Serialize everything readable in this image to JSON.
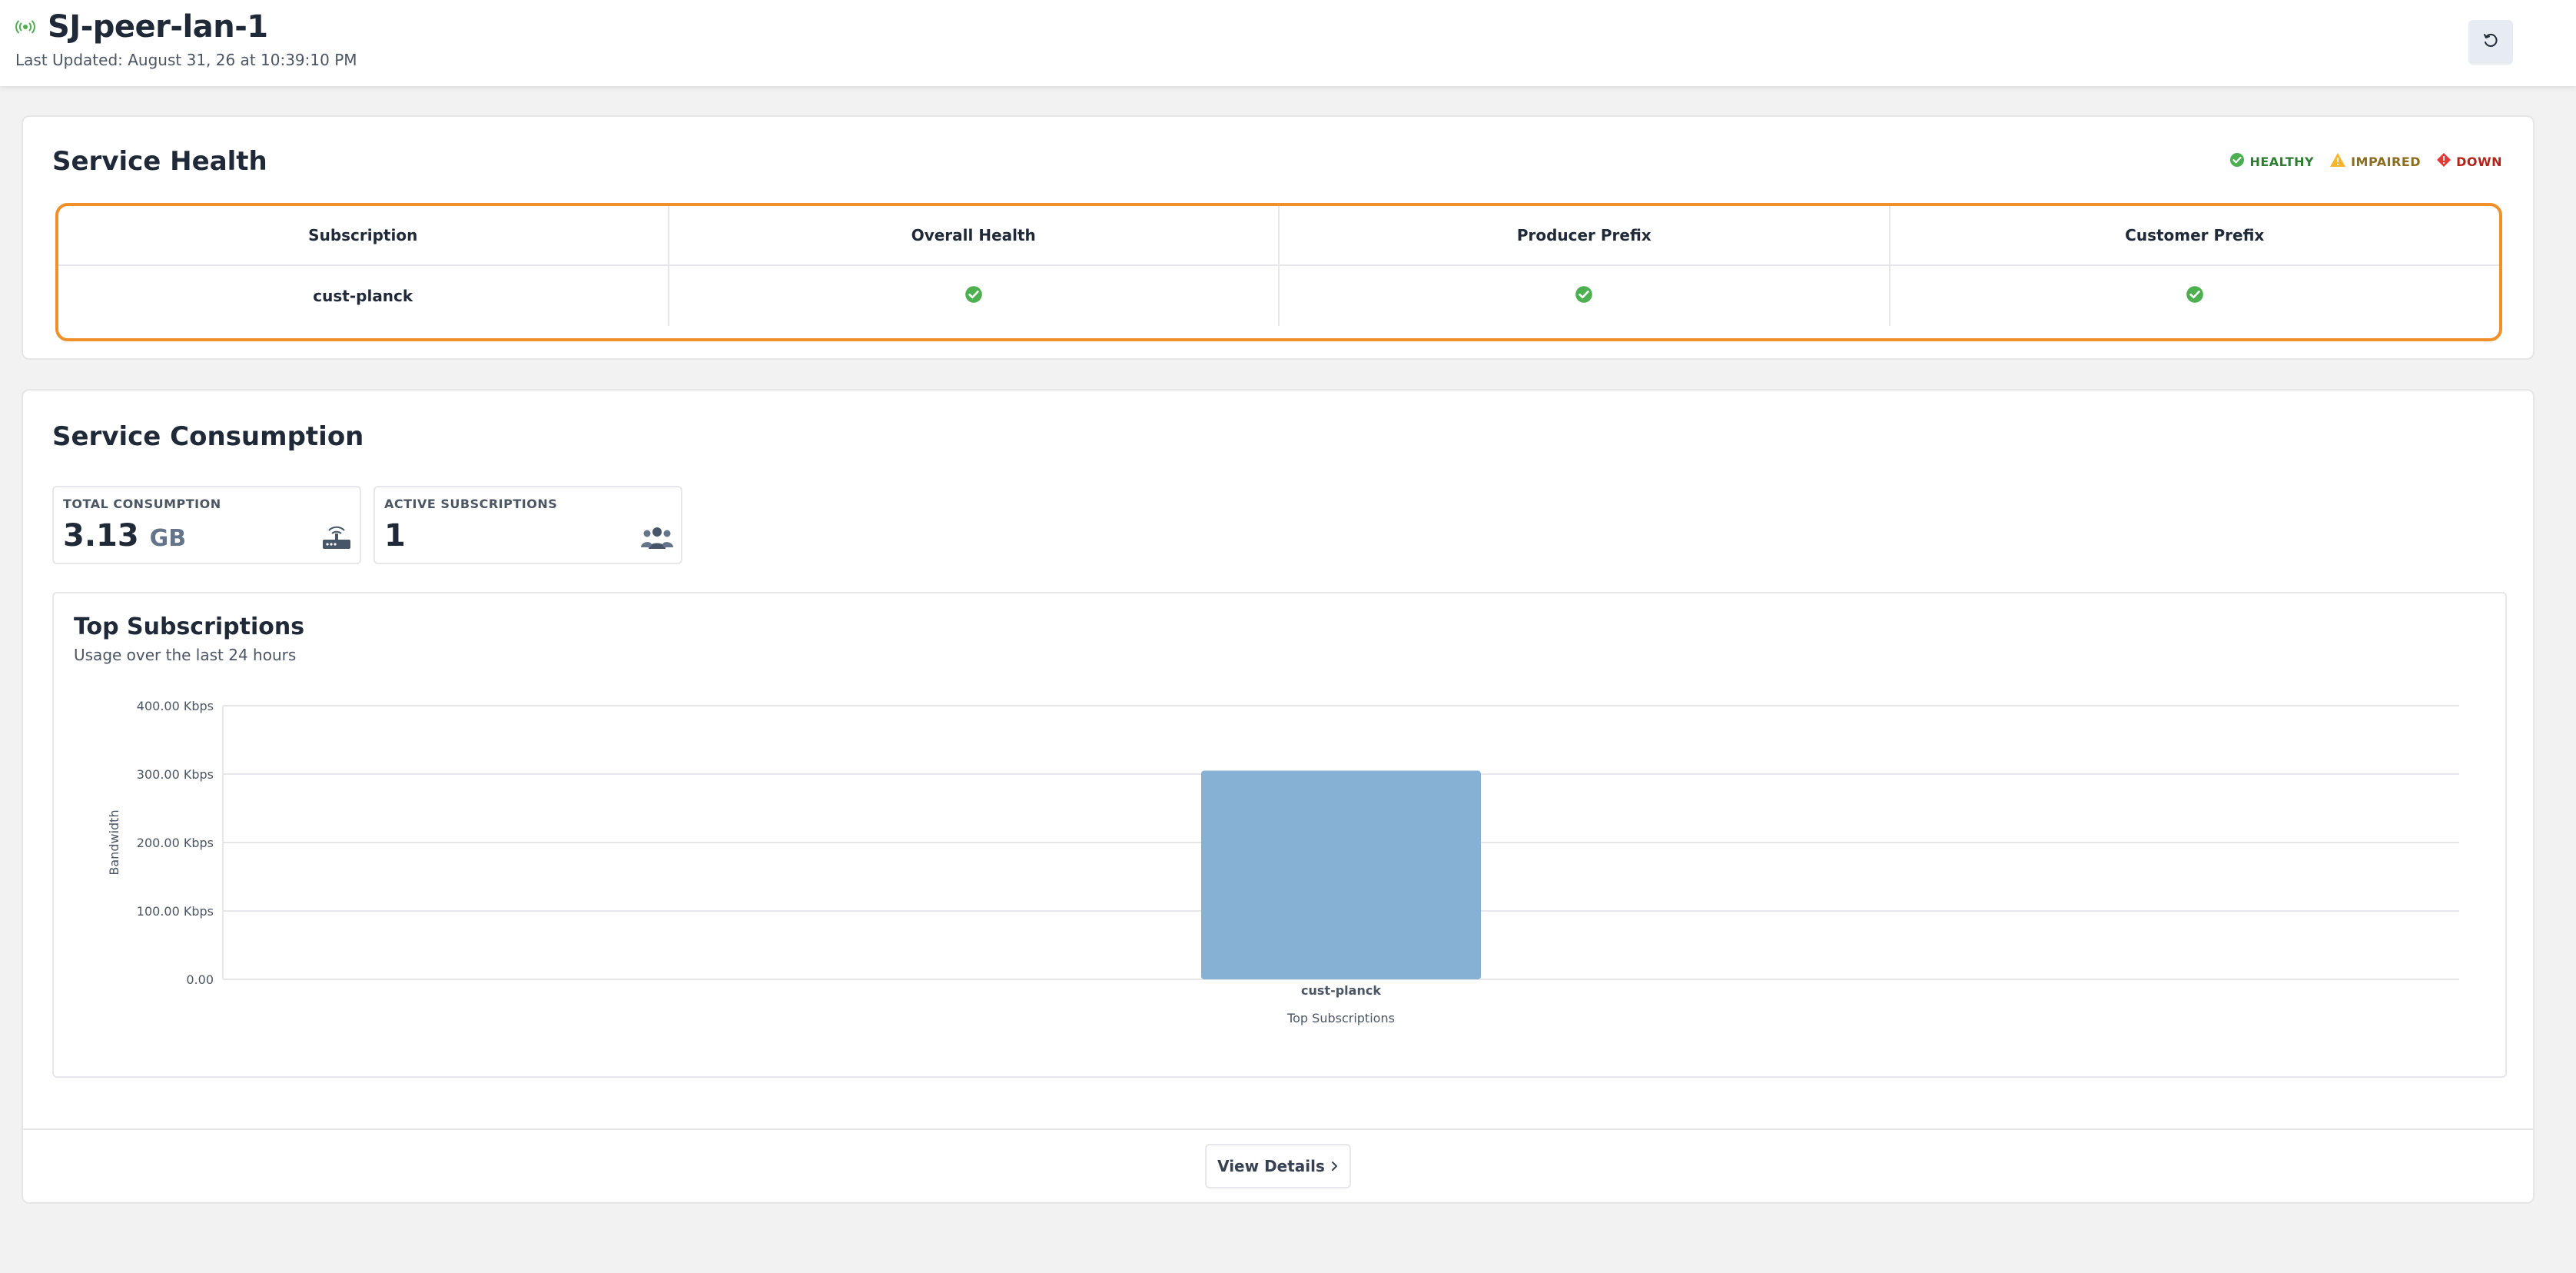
{
  "header": {
    "title": "SJ-peer-lan-1",
    "last_updated": "Last Updated: August 31, 26 at 10:39:10 PM"
  },
  "service_health": {
    "title": "Service Health",
    "legend": [
      {
        "label": "HEALTHY",
        "color": "#2e7d32"
      },
      {
        "label": "IMPAIRED",
        "color": "#8a6d1f"
      },
      {
        "label": "DOWN",
        "color": "#b42318"
      }
    ],
    "columns": [
      "Subscription",
      "Overall Health",
      "Producer Prefix",
      "Customer Prefix"
    ],
    "rows": [
      {
        "subscription": "cust-planck",
        "overall_health": "healthy",
        "producer_prefix": "healthy",
        "customer_prefix": "healthy"
      }
    ],
    "highlight_color": "#f0902a"
  },
  "service_consumption": {
    "title": "Service Consumption",
    "stats": [
      {
        "label": "TOTAL CONSUMPTION",
        "value": "3.13",
        "unit": "GB",
        "icon": "router-icon"
      },
      {
        "label": "ACTIVE SUBSCRIPTIONS",
        "value": "1",
        "unit": "",
        "icon": "users-icon"
      }
    ],
    "view_details_label": "View Details"
  },
  "chart_data": {
    "type": "bar",
    "title": "Top Subscriptions",
    "subtitle": "Usage over the last 24 hours",
    "xlabel": "Top Subscriptions",
    "ylabel": "Bandwidth",
    "categories": [
      "cust-planck"
    ],
    "values": [
      305
    ],
    "unit": "Kbps",
    "ylim": [
      0,
      400
    ],
    "yticks": [
      0,
      100,
      200,
      300,
      400
    ],
    "ytick_labels": [
      "0.00",
      "100.00 Kbps",
      "200.00 Kbps",
      "300.00 Kbps",
      "400.00 Kbps"
    ],
    "bar_color": "#87b1d4",
    "grid": true
  },
  "colors": {
    "healthy": "#4caf50",
    "accent": "#f0902a"
  }
}
